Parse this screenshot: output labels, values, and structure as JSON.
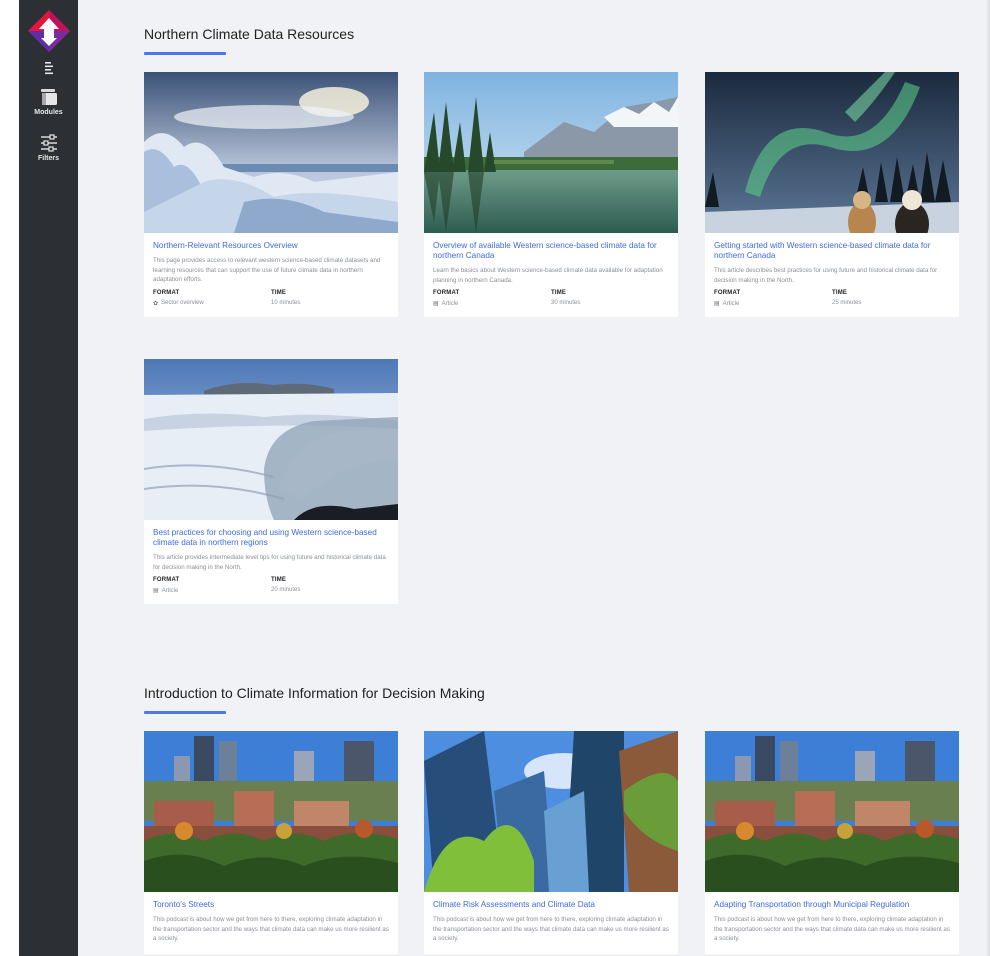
{
  "sidebar": {
    "modules_label": "Modules",
    "filters_label": "Filters"
  },
  "sections": [
    {
      "title": "Northern Climate Data Resources",
      "cards": [
        {
          "title": "Northern-Relevant Resources Overview",
          "description": "This page provides access to relevant western science-based climate datasets and learning resources that can support the use of future climate data in northern adaptation efforts.",
          "format_label": "FORMAT",
          "format_value": "Sector overview",
          "format_icon": "gear-icon",
          "time_label": "TIME",
          "time_value": "10 minutes"
        },
        {
          "title": "Overview of available Western science-based climate data for northern Canada",
          "description": "Learn the basics about Western science-based climate data available for adaptation planning in northern Canada.",
          "format_label": "FORMAT",
          "format_value": "Article",
          "format_icon": "article-icon",
          "time_label": "TIME",
          "time_value": "30 minutes"
        },
        {
          "title": "Getting started with Western science-based climate data for northern Canada",
          "description": "This article describes best practices for using future and historical climate data for decision making in the North.",
          "format_label": "FORMAT",
          "format_value": "Article",
          "format_icon": "article-icon",
          "time_label": "TIME",
          "time_value": "25 minutes"
        },
        {
          "title": "Best practices for choosing and using Western science-based climate data in northern regions",
          "description": "This article provides intermediate level tips for using future and historical climate data for decision making in the North.",
          "format_label": "FORMAT",
          "format_value": "Article",
          "format_icon": "article-icon",
          "time_label": "TIME",
          "time_value": "20 minutes"
        }
      ]
    },
    {
      "title": "Introduction to Climate Information for Decision Making",
      "cards": [
        {
          "title": "Toronto's Streets",
          "description": "This podcast is about how we get from here to there, exploring climate adaptation in the transportation sector and the ways that climate data can make us more resilient as a society."
        },
        {
          "title": "Climate Risk Assessments and Climate Data",
          "description": "This podcast is about how we get from here to there, exploring climate adaptation in the transportation sector and the ways that climate data can make us more resilient as a society."
        },
        {
          "title": "Adapting Transportation through Municipal Regulation",
          "description": "This podcast is about how we get from here to there, exploring climate adaptation in the transportation sector and the ways that climate data can make us more resilient as a society."
        }
      ]
    }
  ],
  "colors": {
    "sidebar_bg": "#2c2f33",
    "accent_blue": "#4a79e8",
    "link_blue": "#3d6ae0",
    "page_bg": "#f0f2f6",
    "logo_red": "#e4163c",
    "logo_purple": "#7a2b9c"
  }
}
